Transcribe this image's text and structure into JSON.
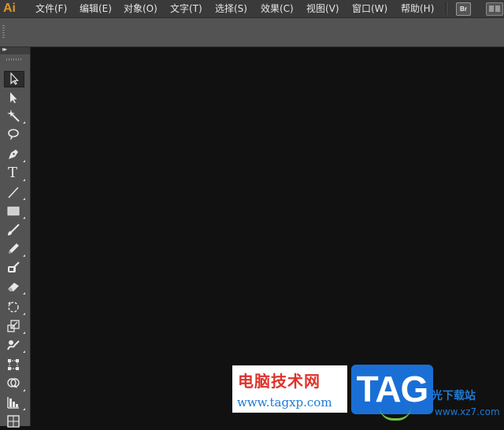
{
  "app": {
    "logo": "Ai"
  },
  "menu": {
    "items": [
      {
        "label": "文件(F)"
      },
      {
        "label": "编辑(E)"
      },
      {
        "label": "对象(O)"
      },
      {
        "label": "文字(T)"
      },
      {
        "label": "选择(S)"
      },
      {
        "label": "效果(C)"
      },
      {
        "label": "视图(V)"
      },
      {
        "label": "窗口(W)"
      },
      {
        "label": "帮助(H)"
      }
    ],
    "bridge_button": "Br",
    "workspace_icon": "workspace-switcher-icon"
  },
  "toolbar": {
    "collapse_label": "▸▸",
    "tools": [
      {
        "icon": "selection-tool-icon",
        "active": true
      },
      {
        "icon": "direct-selection-tool-icon"
      },
      {
        "icon": "magic-wand-tool-icon"
      },
      {
        "icon": "lasso-tool-icon"
      },
      {
        "icon": "pen-tool-icon"
      },
      {
        "icon": "type-tool-icon",
        "glyph": "T"
      },
      {
        "icon": "line-segment-tool-icon"
      },
      {
        "icon": "rectangle-tool-icon"
      },
      {
        "icon": "paintbrush-tool-icon"
      },
      {
        "icon": "pencil-tool-icon"
      },
      {
        "icon": "blob-brush-tool-icon"
      },
      {
        "icon": "eraser-tool-icon"
      },
      {
        "icon": "rotate-tool-icon"
      },
      {
        "icon": "scale-tool-icon"
      },
      {
        "icon": "warp-tool-icon"
      },
      {
        "icon": "free-transform-tool-icon"
      },
      {
        "icon": "shape-builder-tool-icon"
      },
      {
        "icon": "graph-tool-icon"
      },
      {
        "icon": "mesh-tool-icon"
      }
    ]
  },
  "watermark": {
    "title": "电脑技术网",
    "url": "www.tagxp.com",
    "badge": "TAG",
    "side_text": "光下载站",
    "side_url": "www.xz7.com"
  },
  "colors": {
    "menubar_bg": "#3a3a3a",
    "panel_bg": "#535353",
    "canvas_bg": "#111111",
    "logo_orange": "#d9962a"
  }
}
